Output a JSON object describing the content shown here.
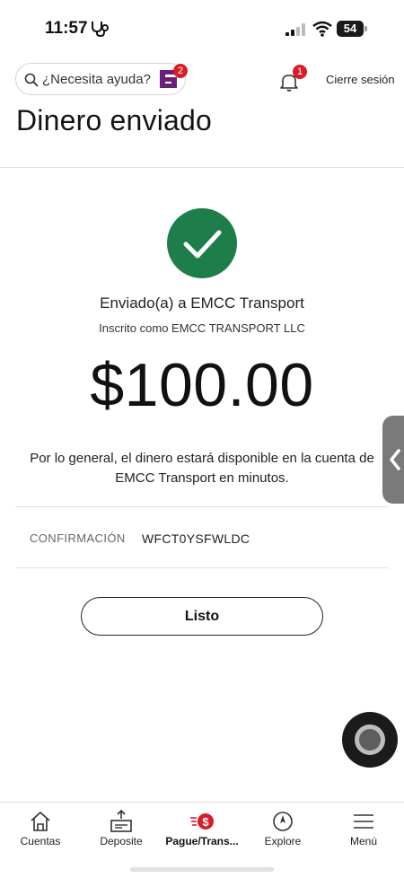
{
  "status_bar": {
    "time": "11:57",
    "battery": "54"
  },
  "header": {
    "help_placeholder": "¿Necesita ayuda?",
    "assistant_badge": "2",
    "notifications_badge": "1",
    "logout": "Cierre sesión",
    "page_title": "Dinero enviado"
  },
  "confirmation": {
    "recipient": "Enviado(a) a EMCC Transport",
    "enrolled_as": "Inscrito como EMCC TRANSPORT LLC",
    "amount": "$100.00",
    "availability_note": "Por lo general, el dinero estará disponible en la cuenta de EMCC Transport en minutos.",
    "confirmation_label": "CONFIRMACIÓN",
    "confirmation_number": "WFCT0YSFWLDC",
    "done_button": "Listo"
  },
  "tabs": [
    {
      "label": "Cuentas",
      "icon": "home-icon",
      "active": false
    },
    {
      "label": "Deposite",
      "icon": "deposit-icon",
      "active": false
    },
    {
      "label": "Pague/Trans...",
      "icon": "pay-transfer-icon",
      "active": true
    },
    {
      "label": "Explore",
      "icon": "compass-icon",
      "active": false
    },
    {
      "label": "Menú",
      "icon": "menu-icon",
      "active": false
    }
  ],
  "colors": {
    "success_green": "#1e7e4a",
    "badge_red": "#d71e28",
    "assistant_purple": "#6b1f7c"
  }
}
